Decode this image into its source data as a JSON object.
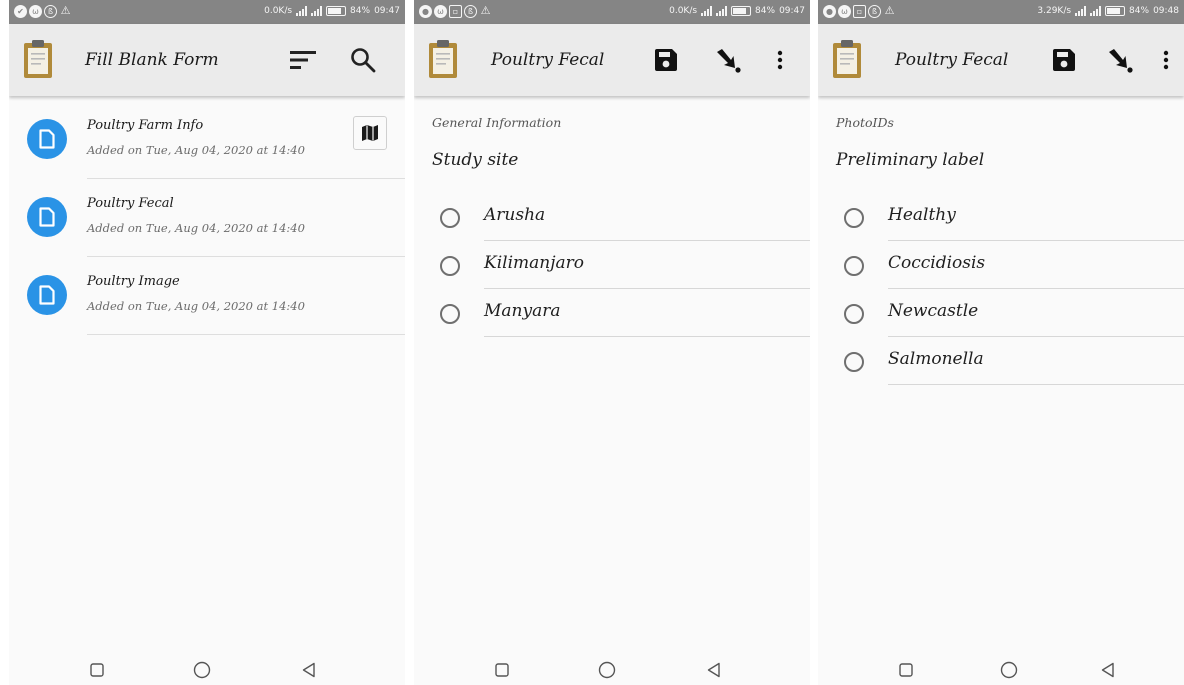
{
  "status_bar": {
    "screen1": {
      "speed": "0.0K/s",
      "battery": "84%",
      "time": "09:47"
    },
    "screen2": {
      "speed": "0.0K/s",
      "battery": "84%",
      "time": "09:47"
    },
    "screen3": {
      "speed": "3.29K/s",
      "battery": "84%",
      "time": "09:48"
    }
  },
  "screen1": {
    "title": "Fill Blank Form",
    "icons": {
      "logo": "clipboard-icon",
      "sort": "sort-icon",
      "search": "search-icon"
    },
    "forms": [
      {
        "name": "Poultry Farm Info",
        "added": "Added on Tue, Aug 04, 2020 at 14:40",
        "has_map": true
      },
      {
        "name": "Poultry Fecal",
        "added": "Added on Tue, Aug 04, 2020 at 14:40",
        "has_map": false
      },
      {
        "name": "Poultry Image",
        "added": "Added on Tue, Aug 04, 2020 at 14:40",
        "has_map": false
      }
    ]
  },
  "screen2": {
    "title": "Poultry Fecal",
    "icons": {
      "save": "save-icon",
      "jump": "jump-arrow-icon",
      "menu": "more-vert-icon"
    },
    "group": "General Information",
    "question": "Study site",
    "options": [
      "Arusha",
      "Kilimanjaro",
      "Manyara"
    ]
  },
  "screen3": {
    "title": "Poultry Fecal",
    "icons": {
      "save": "save-icon",
      "jump": "jump-arrow-icon",
      "menu": "more-vert-icon"
    },
    "group": "PhotoIDs",
    "question": "Preliminary label",
    "options": [
      "Healthy",
      "Coccidiosis",
      "Newcastle",
      "Salmonella"
    ]
  },
  "nav_bar": {
    "icons": [
      "recents-square-icon",
      "home-circle-icon",
      "back-triangle-icon"
    ]
  },
  "colors": {
    "accent": "#2a93e6",
    "toolbar": "#ebebeb",
    "status_bar": "#858585",
    "clipboard": "#b08a3a"
  }
}
